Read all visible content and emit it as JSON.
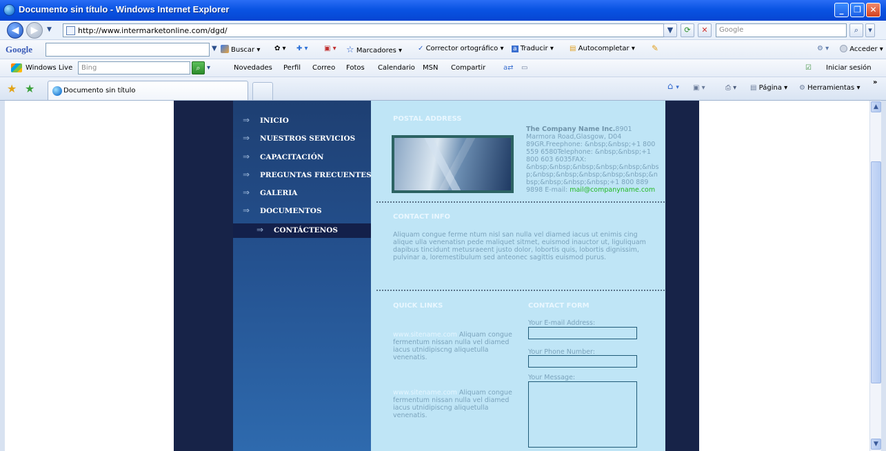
{
  "window": {
    "title": "Documento sin título - Windows Internet Explorer",
    "minimize": "_",
    "restore": "❐",
    "close": "✕"
  },
  "address_bar": {
    "url": "http://www.intermarketonline.com/dgd/",
    "search_placeholder": "Google"
  },
  "google_toolbar": {
    "logo": "Google",
    "buscar": "Buscar",
    "marcadores": "Marcadores",
    "corrector": "Corrector ortográfico",
    "traducir": "Traducir",
    "autocompletar": "Autocompletar",
    "acceder": "Acceder"
  },
  "live_toolbar": {
    "brand": "Windows Live",
    "search_placeholder": "Bing",
    "items": [
      "Novedades",
      "Perfil",
      "Correo",
      "Fotos",
      "Calendario",
      "MSN",
      "Compartir"
    ],
    "signin": "Iniciar sesión"
  },
  "tabs": {
    "active_label": "Documento sin título",
    "commands": {
      "pagina": "Página",
      "herramientas": "Herramientas"
    }
  },
  "site": {
    "nav": [
      "INICIO",
      "NUESTROS SERVICIOS",
      "CAPACITACIÓN",
      "PREGUNTAS FRECUENTES",
      "GALERIA",
      "DOCUMENTOS",
      "CONTÁCTENOS"
    ],
    "postal_title": "POSTAL ADDRESS",
    "company_name": "The Company Name Inc.",
    "address_body": "8901 Marmora Road,Glasgow, D04 89GR.Freephone: &nbsp;&nbsp;+1 800 559 6580Telephone: &nbsp;&nbsp;+1 800 603 6035FAX: &nbsp;&nbsp;&nbsp;&nbsp;&nbsp;&nbsp;&nbsp;&nbsp;&nbsp;&nbsp;&nbsp;&nbsp;&nbsp;&nbsp;&nbsp;+1 800 889 9898 E-mail:",
    "email": "mail@companyname.com",
    "contact_info_title": "CONTACT INFO",
    "contact_info_body": "Aliquam congue ferme ntum nisl san nulla vel diamed iacus ut enimis cing alique ulla venenatisn pede maliquet sitmet, euismod inauctor ut, liguliquam dapibus tincidunt metusraeent justo dolor, lobortis quis, lobortis dignissim, pulvinar a, loremestibulum sed anteonec sagittis euismod purus.",
    "quick_links_title": "QUICK LINKS",
    "quick_links": [
      {
        "site": "www.sitename.com",
        "text": "Aliquam congue fermentum nissan nulla vel diamed iacus utnidipiscng aliquetulla venenatis."
      },
      {
        "site": "www.sitename.com",
        "text": "Aliquam congue fermentum nissan nulla vel diamed iacus utnidipiscng aliquetulla venenatis."
      }
    ],
    "contact_form_title": "CONTACT FORM",
    "form": {
      "email_label": "Your E-mail Address:",
      "phone_label": "Your Phone Number:",
      "message_label": "Your Message:"
    }
  }
}
